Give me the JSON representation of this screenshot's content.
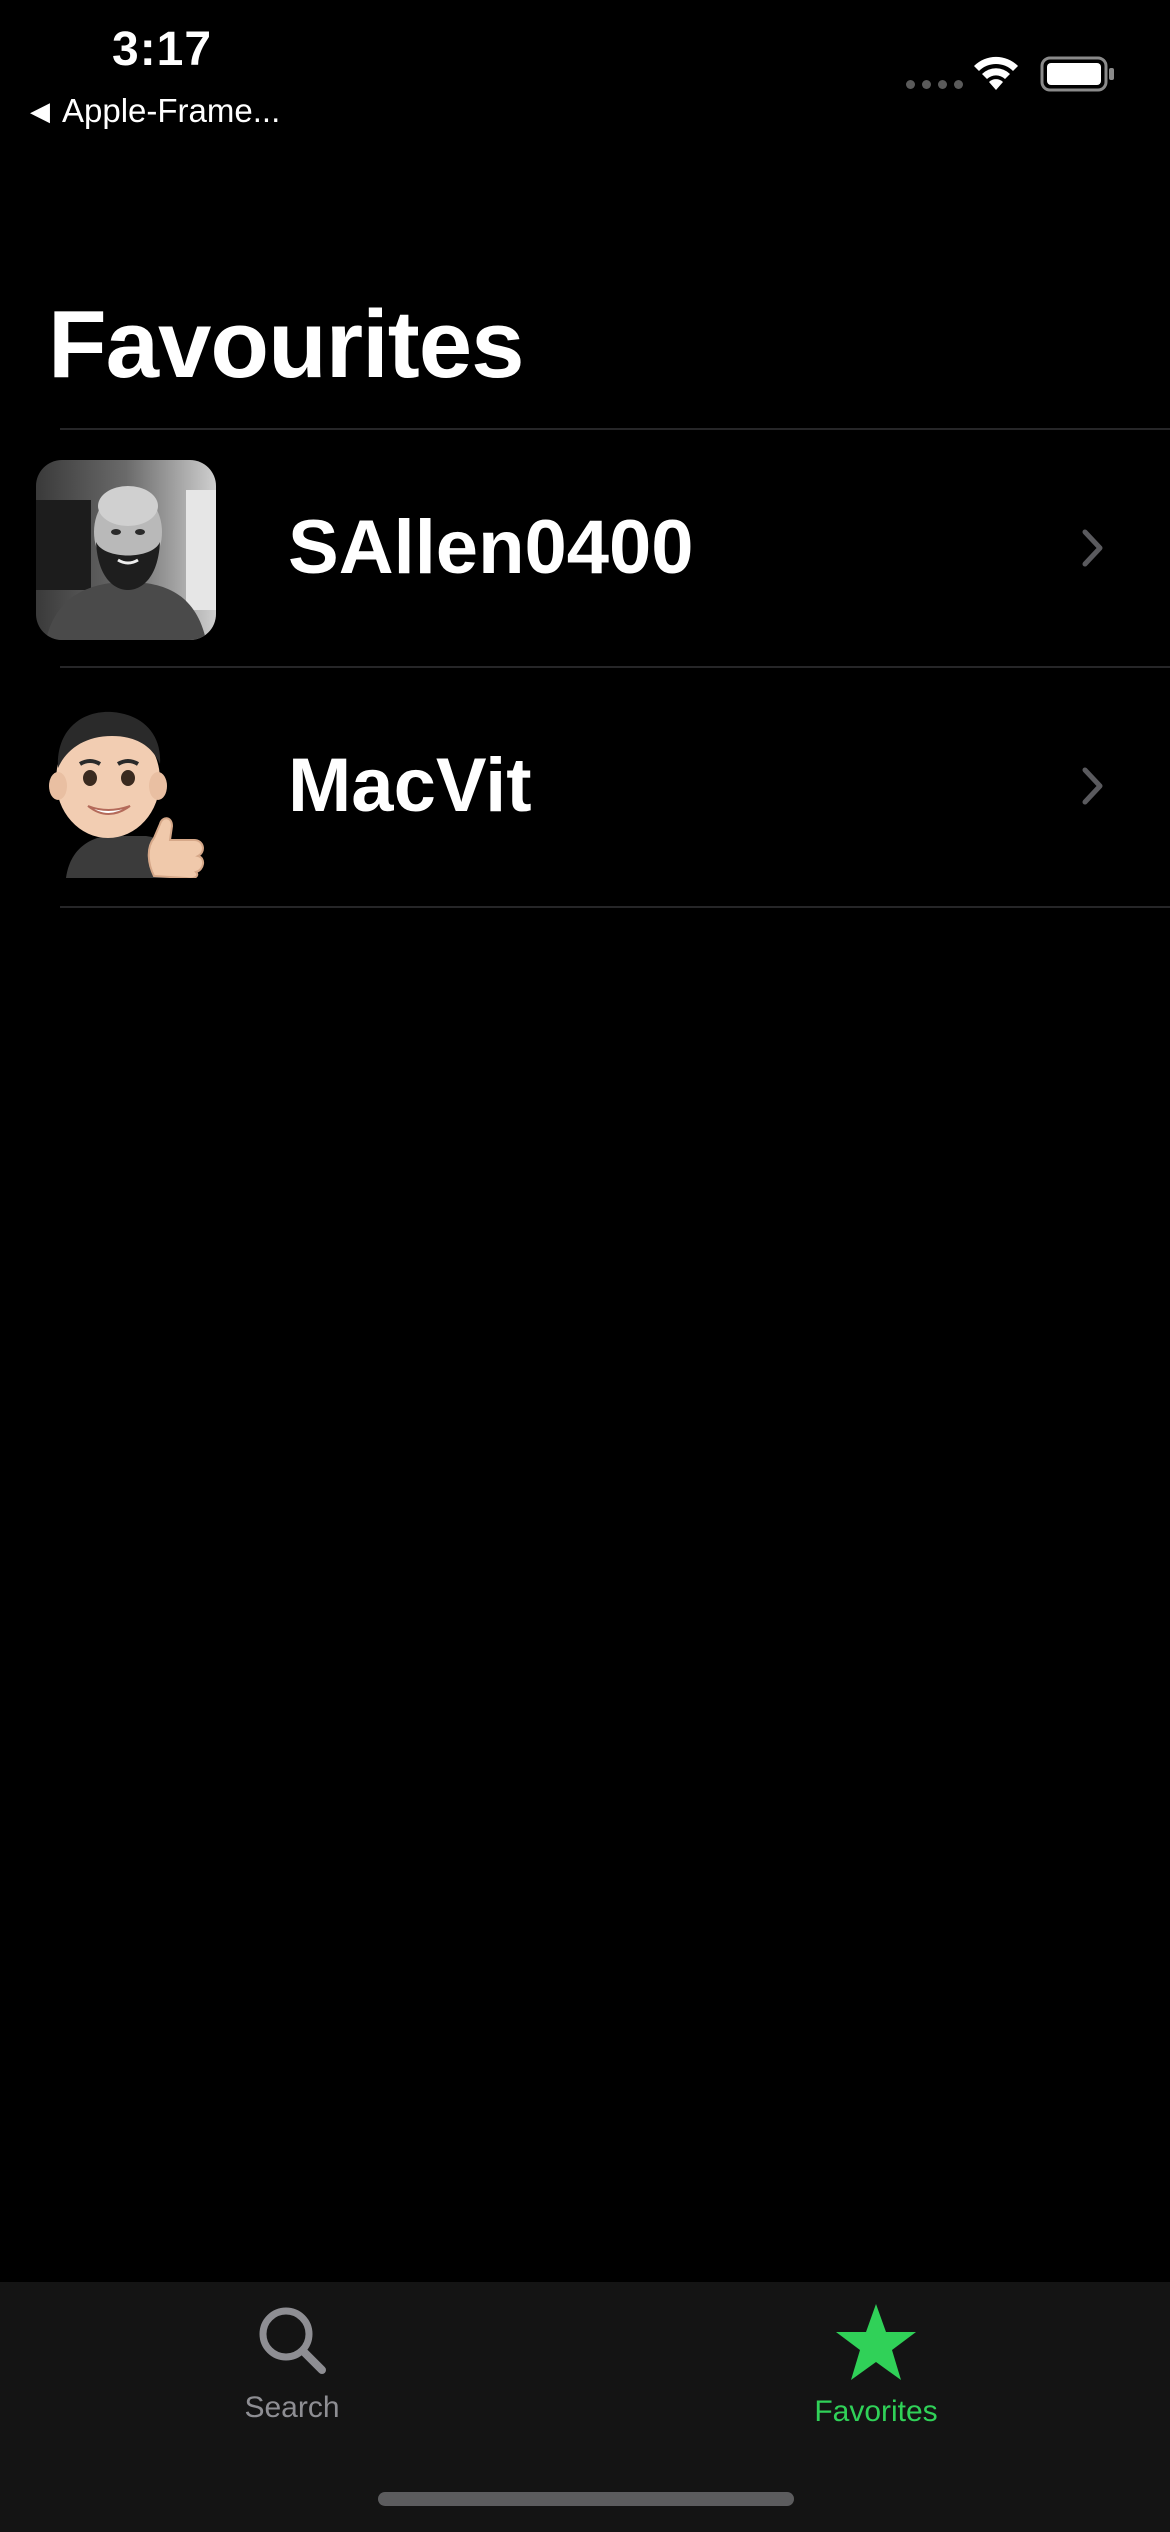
{
  "status_bar": {
    "time": "3:17",
    "back_app": "Apple-Frame...",
    "back_icon": "back-triangle-icon",
    "signal_icon": "cellular-signal-icon",
    "wifi_icon": "wifi-icon",
    "battery_icon": "battery-icon"
  },
  "title": "Favourites",
  "favorites": [
    {
      "name": "SAllen0400",
      "avatar": "profile-photo",
      "chevron_icon": "chevron-right-icon"
    },
    {
      "name": "MacVit",
      "avatar": "memoji-thumbs-up",
      "chevron_icon": "chevron-right-icon"
    }
  ],
  "tab_bar": {
    "tabs": [
      {
        "label": "Search",
        "icon": "magnifying-glass-icon",
        "selected": false
      },
      {
        "label": "Favorites",
        "icon": "star-icon",
        "selected": true
      }
    ],
    "selected_color": "#30d158",
    "unselected_color": "#8e8e93"
  }
}
